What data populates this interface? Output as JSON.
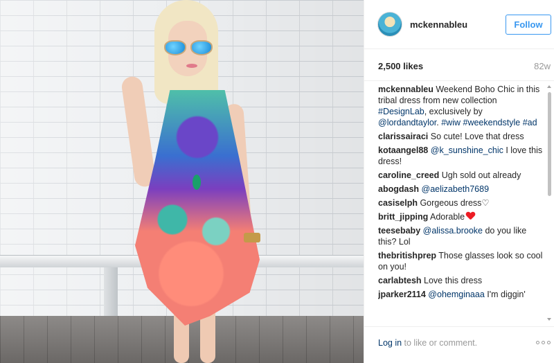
{
  "post": {
    "image_alt": "Woman in tribal print dress against white brick wall"
  },
  "header": {
    "username": "mckennableu",
    "follow_label": "Follow"
  },
  "stats": {
    "likes": "2,500 likes",
    "age": "82w"
  },
  "caption": {
    "user": "mckennableu",
    "text": " Weekend Boho Chic in this tribal dress from new collection ",
    "tag1": "#DesignLab",
    "text2": ", exclusively by ",
    "mention": "@lordandtaylor",
    "text3": ". ",
    "tag2": "#wiw",
    "tag3": "#weekendstyle",
    "tag4": "#ad"
  },
  "comments": [
    {
      "user": "clarissairaci",
      "text": " So cute! Love that dress"
    },
    {
      "user": "kotaangel88",
      "mention": "@k_sunshine_chic",
      "text": " I love this dress!"
    },
    {
      "user": "caroline_creed",
      "text": " Ugh sold out already"
    },
    {
      "user": "abogdash",
      "mention": "@aelizabeth7689"
    },
    {
      "user": "casiselph",
      "text": " Gorgeous dress♡"
    },
    {
      "user": "britt_jipping",
      "text": " Adorable"
    },
    {
      "user": "teesebaby",
      "mention": "@alissa.brooke",
      "text": " do you like this? Lol"
    },
    {
      "user": "thebritishprep",
      "text": " Those glasses look so cool on you!"
    },
    {
      "user": "carlabtesh",
      "text": " Love this dress"
    },
    {
      "user": "jparker2114",
      "mention": "@ohemginaaa",
      "text": " I'm diggin'"
    }
  ],
  "footer": {
    "login_link": "Log in",
    "login_rest": " to like or comment."
  },
  "icons": {
    "heart": "heart-icon",
    "more": "more-options-icon"
  },
  "colors": {
    "accent": "#3897f0",
    "link": "#003569",
    "heart": "#ed1c24"
  }
}
